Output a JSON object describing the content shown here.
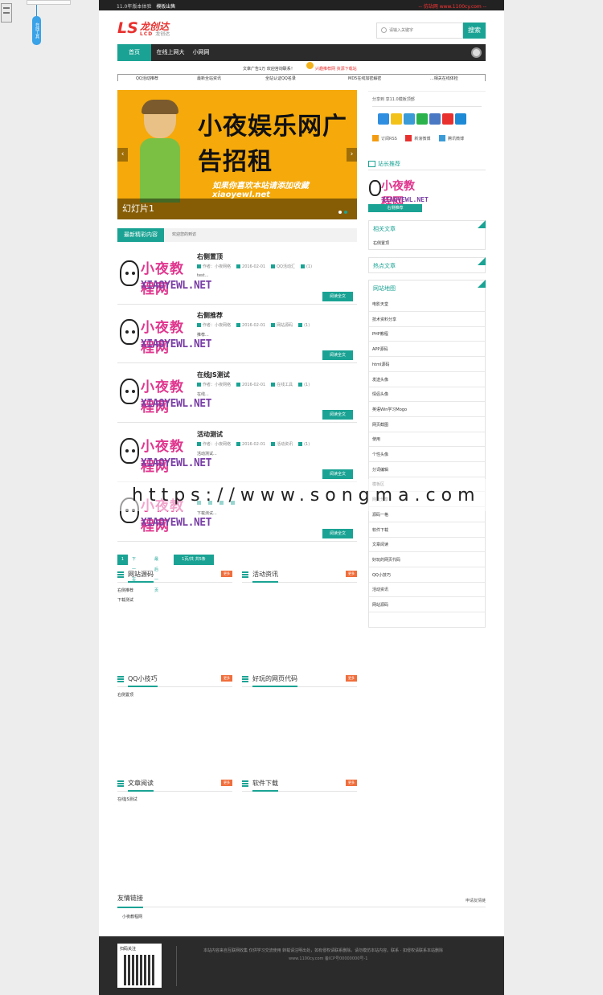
{
  "topbar": {
    "left": "11.0年版本体验",
    "left_bold": "模板出售",
    "right": "-- 仿站网 www.1100cy.com --"
  },
  "sidewidget": {
    "tag": "在线工具"
  },
  "logo": {
    "mark": "LS",
    "cn": "龙创达",
    "en": "LCD",
    "en_sub": "龙创达"
  },
  "search": {
    "placeholder": "请输入关键字",
    "button": "搜索"
  },
  "nav": {
    "items": [
      "首页",
      "在线上网大",
      "小网网"
    ]
  },
  "notice": {
    "ad": "文章广告1万 欢迎咨询联系！",
    "link": "兴趣推荐网 资源下载站"
  },
  "topics": [
    "QQ活动推荐",
    "最新全站资讯",
    "全站认证QQ名录",
    "MD5在线加密解密",
    "...相关在线体检"
  ],
  "slider": {
    "headline": "小夜娱乐网广告招租",
    "sub": "如果你喜欢本站请添加收藏 xiaoyewl.net",
    "caption": "幻灯片1",
    "prev": "‹",
    "next": "›"
  },
  "tabs": {
    "active": "最新精彩内容",
    "inactive": "欢迎您的到访"
  },
  "thumb": {
    "cn": "小夜教程网",
    "en": "XIAOYEWL.NET"
  },
  "posts": [
    {
      "title": "右侧置顶",
      "author": "作者：小夜网络",
      "date": "2016-02-01",
      "cat": "QQ活动汇",
      "comments": "(1)",
      "excerpt": "test...",
      "more": "阅读全文"
    },
    {
      "title": "右侧推荐",
      "author": "作者：小夜网络",
      "date": "2016-02-01",
      "cat": "网站源码",
      "comments": "(1)",
      "excerpt": "推荐...",
      "more": "阅读全文"
    },
    {
      "title": "在线JS测试",
      "author": "作者：小夜网络",
      "date": "2016-02-01",
      "cat": "在线工具",
      "comments": "(1)",
      "excerpt": "在线...",
      "more": "阅读全文"
    },
    {
      "title": "活动测试",
      "author": "作者：小夜网络",
      "date": "2016-02-01",
      "cat": "活动资讯",
      "comments": "(1)",
      "excerpt": "活动测试...",
      "more": "阅读全文"
    },
    {
      "title": "",
      "author": "",
      "date": "",
      "cat": "",
      "comments": "",
      "excerpt": "下载测试...",
      "more": "阅读全文"
    }
  ],
  "pager": {
    "current": "1",
    "next": "下一页",
    "last": "最后一页",
    "total": "1页/共 共5条"
  },
  "blocks": [
    {
      "title": "网站源码",
      "more": "更多",
      "items": [
        "右侧推荐",
        "下载测试"
      ]
    },
    {
      "title": "活动资讯",
      "more": "更多",
      "items": []
    },
    {
      "title": "QQ小技巧",
      "more": "更多",
      "items": [
        "右侧置顶"
      ]
    },
    {
      "title": "好玩的网页代码",
      "more": "更多",
      "items": []
    },
    {
      "title": "文章阅读",
      "more": "更多",
      "items": [
        "在线JS测试"
      ]
    },
    {
      "title": "软件下载",
      "more": "更多",
      "items": []
    }
  ],
  "share": {
    "header": "分享到 享11.0模板顶部",
    "rss1": "订阅RSS",
    "rss2": "新浪微博",
    "rss3": "腾讯微博"
  },
  "sidebar": {
    "rec_title": "站长推荐",
    "rec_bar": "右侧推荐",
    "related_title": "相关文章",
    "related_item": "右侧置顶",
    "hot_title": "热点文章",
    "map_title": "网站地图",
    "map_items": [
      "电影天堂",
      "技术资料分享",
      "PHP教程",
      "APP源码",
      "html源码",
      "发送头像",
      "情侣头像",
      "英语Win学习Mogo",
      "网页截图",
      "使用",
      "个性头像",
      "分词编辑",
      "模板区",
      "网页分享",
      "源码一格",
      "软件下载",
      "文章阅读",
      "好玩的网页代码",
      "QQ小技巧",
      "活动资讯",
      "网站源码"
    ]
  },
  "watermark": "https://www.songma.com",
  "friendlinks": {
    "title": "友情链接",
    "apply": "申请友情链",
    "item": "小夜教程网"
  },
  "footer": {
    "qr_label": "扫码关注",
    "line1": "本站内容来自互联网收集 仅供学习交流使用 转载请注明出处，如有侵权请联系删除。请勿模仿本站内容。联系 · 如侵权请联系本站删除",
    "line2": "www.1100cy.com 备ICP号00000000号-1"
  },
  "colors": {
    "accent": "#1aa394",
    "brand_red": "#e8312f",
    "dark": "#2b2b2b",
    "orange": "#f06e3c"
  }
}
